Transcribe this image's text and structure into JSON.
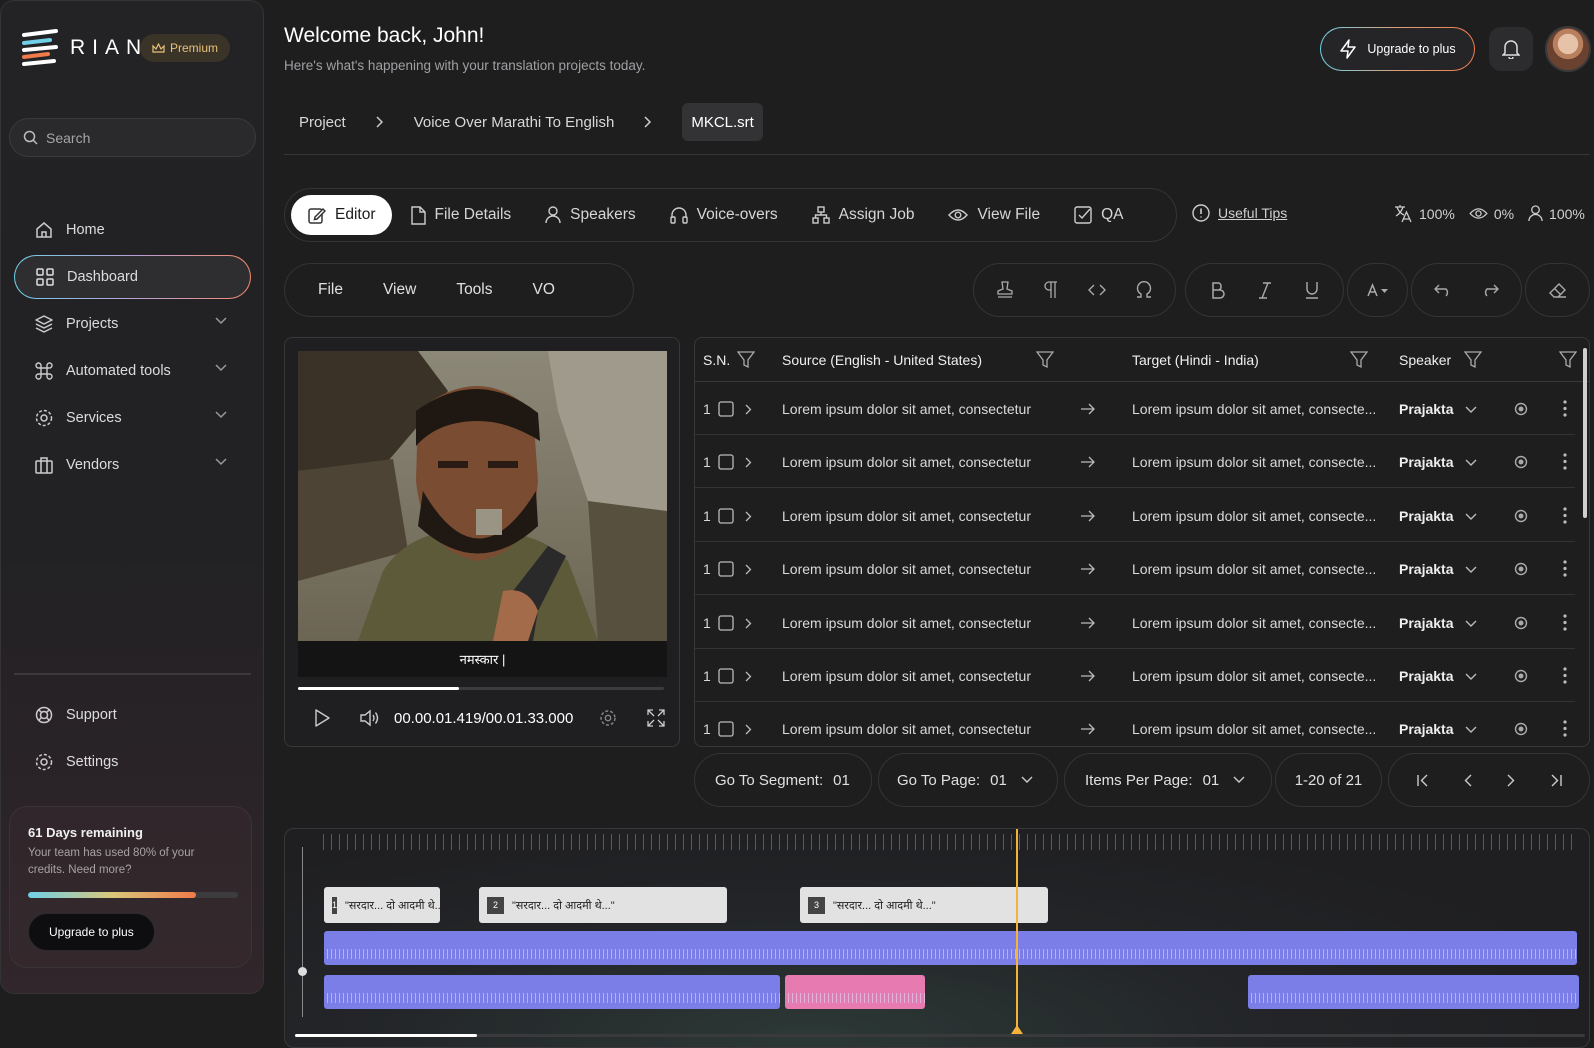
{
  "app": {
    "brand": "RIAN",
    "badge": "Premium"
  },
  "search": {
    "placeholder": "Search"
  },
  "nav": {
    "home": "Home",
    "dashboard": "Dashboard",
    "projects": "Projects",
    "automated": "Automated tools",
    "services": "Services",
    "vendors": "Vendors",
    "support": "Support",
    "settings": "Settings"
  },
  "credits": {
    "title": "61 Days remaining",
    "text": "Your team has used 80% of your credits. Need more?",
    "used_fraction": 0.8,
    "button": "Upgrade to plus"
  },
  "header": {
    "title": "Welcome back, John!",
    "subtitle": "Here's what's happening with your translation projects today.",
    "upgrade": "Upgrade to plus"
  },
  "breadcrumb": [
    "Project",
    "Voice Over Marathi To English",
    "MKCL.srt"
  ],
  "tabs": {
    "editor": "Editor",
    "file_details": "File Details",
    "speakers": "Speakers",
    "voiceovers": "Voice-overs",
    "assign_job": "Assign Job",
    "view_file": "View File",
    "qa": "QA"
  },
  "tips": "Useful Tips",
  "stats": {
    "translated": "100%",
    "viewed": "0%",
    "assigned": "100%"
  },
  "menus": {
    "file": "File",
    "view": "View",
    "tools": "Tools",
    "vo": "VO"
  },
  "video": {
    "subtitle": "नमस्कार |",
    "timecode": "00.00.01.419/00.01.33.000",
    "progress_fraction": 0.44
  },
  "table": {
    "headers": {
      "sn": "S.N.",
      "source": "Source (English - United States)",
      "target": "Target (Hindi - India)",
      "speaker": "Speaker"
    },
    "rows": [
      {
        "sn": "1",
        "source": "Lorem ipsum dolor sit amet, consectetur",
        "target": "Lorem ipsum dolor sit amet, consecte...",
        "speaker": "Prajakta"
      },
      {
        "sn": "1",
        "source": "Lorem ipsum dolor sit amet, consectetur",
        "target": "Lorem ipsum dolor sit amet, consecte...",
        "speaker": "Prajakta"
      },
      {
        "sn": "1",
        "source": "Lorem ipsum dolor sit amet, consectetur",
        "target": "Lorem ipsum dolor sit amet, consecte...",
        "speaker": "Prajakta"
      },
      {
        "sn": "1",
        "source": "Lorem ipsum dolor sit amet, consectetur",
        "target": "Lorem ipsum dolor sit amet, consecte...",
        "speaker": "Prajakta"
      },
      {
        "sn": "1",
        "source": "Lorem ipsum dolor sit amet, consectetur",
        "target": "Lorem ipsum dolor sit amet, consecte...",
        "speaker": "Prajakta"
      },
      {
        "sn": "1",
        "source": "Lorem ipsum dolor sit amet, consectetur",
        "target": "Lorem ipsum dolor sit amet, consecte...",
        "speaker": "Prajakta"
      },
      {
        "sn": "1",
        "source": "Lorem ipsum dolor sit amet, consectetur",
        "target": "Lorem ipsum dolor sit amet, consecte...",
        "speaker": "Prajakta"
      }
    ]
  },
  "pager": {
    "goto_segment_label": "Go To Segment:",
    "goto_segment": "01",
    "goto_page_label": "Go To Page:",
    "goto_page": "01",
    "items_label": "Items Per Page:",
    "items": "01",
    "range": "1-20 of 21"
  },
  "timeline": {
    "clips": [
      {
        "num": "1",
        "text": "\"सरदार... दो आदमी थे...\""
      },
      {
        "num": "2",
        "text": "\"सरदार... दो आदमी थे...\""
      },
      {
        "num": "3",
        "text": "\"सरदार... दो आदमी थे...\""
      }
    ]
  },
  "colors": {
    "accent_cyan": "#6fd0e8",
    "accent_orange": "#f07a4a",
    "waveform": "#7b7ee6",
    "waveform_alt": "#e77ab0",
    "playhead": "#f4b23a"
  }
}
